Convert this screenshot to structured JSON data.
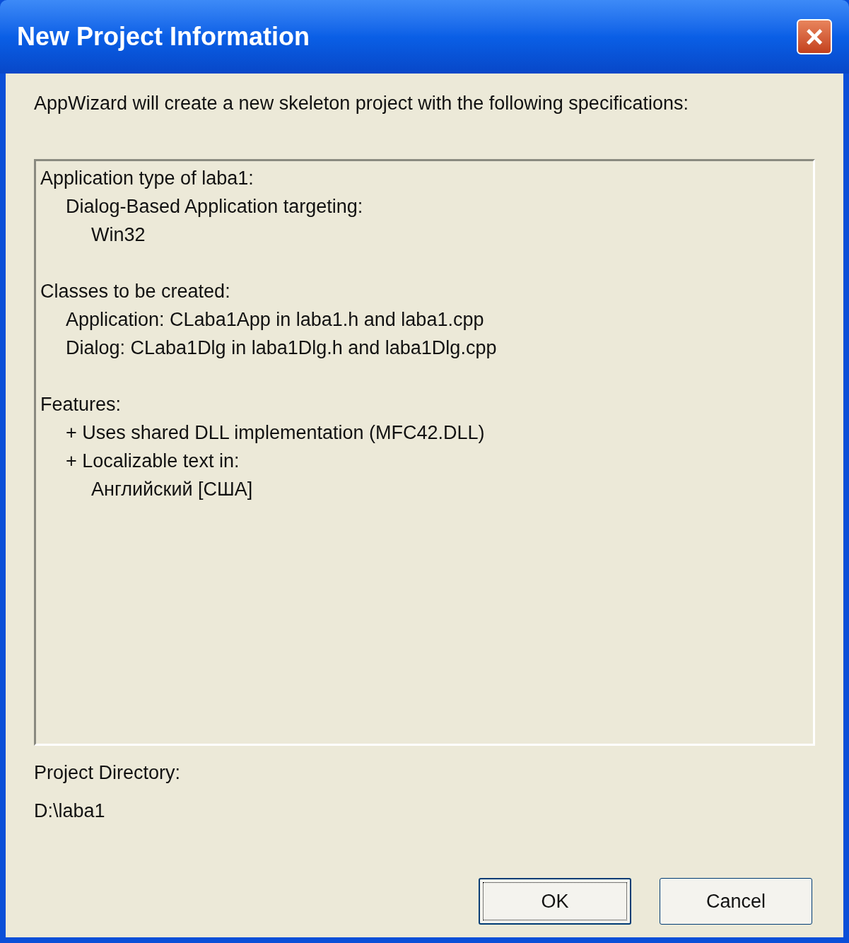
{
  "window": {
    "title": "New Project Information",
    "close_label": "×"
  },
  "intro": "AppWizard will create a new skeleton project with the following specifications:",
  "specifications": [
    {
      "text": "Application type of laba1:",
      "children": [
        {
          "text": "Dialog-Based Application targeting:",
          "children": [
            {
              "text": "Win32"
            }
          ]
        }
      ]
    },
    {
      "text": "Classes to be created:",
      "children": [
        {
          "text": "Application: CLaba1App in laba1.h and laba1.cpp"
        },
        {
          "text": "Dialog: CLaba1Dlg in laba1Dlg.h and laba1Dlg.cpp"
        }
      ]
    },
    {
      "text": "Features:",
      "children": [
        {
          "text": "+ Uses shared DLL implementation (MFC42.DLL)"
        },
        {
          "text": "+ Localizable text in:",
          "children": [
            {
              "text": "Английский [США]"
            }
          ]
        }
      ]
    }
  ],
  "project_directory": {
    "label": "Project Directory:",
    "value": "D:\\laba1"
  },
  "buttons": [
    {
      "label": "OK",
      "focused": true
    },
    {
      "label": "Cancel",
      "focused": false
    }
  ]
}
